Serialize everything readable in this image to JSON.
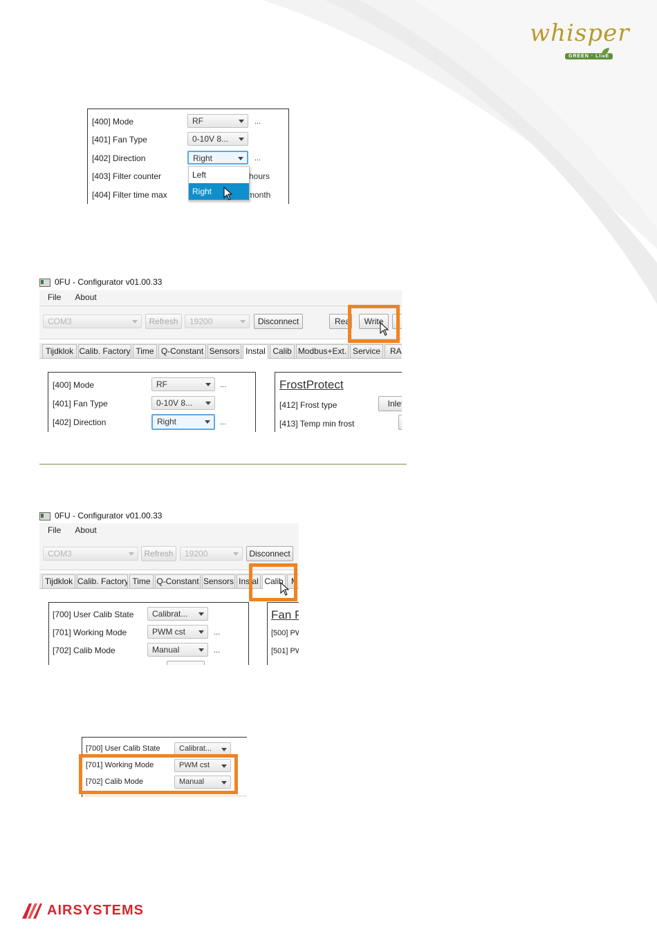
{
  "brand": {
    "whisper": "whisper",
    "whisper_sub": "GREEN · LINE",
    "footer": "AIRSYSTEMS",
    "accent_orange": "#f08321",
    "footer_red": "#d6262f",
    "gold": "#b89a2a"
  },
  "panel1": {
    "rows": [
      {
        "label": "[400] Mode",
        "value": "RF",
        "extra": "..."
      },
      {
        "label": "[401] Fan Type",
        "value": "0-10V 8...",
        "extra": ""
      },
      {
        "label": "[402] Direction",
        "value": "Right",
        "extra": "..."
      },
      {
        "label": "[403] Filter counter",
        "value": "",
        "extra": "hours"
      },
      {
        "label": "[404] Filter time max",
        "value": "",
        "extra": "month"
      }
    ],
    "dropdown": [
      "Left",
      "Right"
    ]
  },
  "window1": {
    "title": "0FU - Configurator v01.00.33",
    "menu": [
      "File",
      "About"
    ],
    "port": "COM3",
    "refresh": "Refresh",
    "baud": "19200",
    "disconnect": "Disconnect",
    "read": "Read",
    "write": "Write",
    "tabs": [
      "Tijdklok",
      "Calib. Factory",
      "Time",
      "Q-Constant",
      "Sensors",
      "Instal",
      "Calib",
      "Modbus+Ext.",
      "Service",
      "RAM"
    ],
    "rows": [
      {
        "label": "[400] Mode",
        "value": "RF",
        "extra": "..."
      },
      {
        "label": "[401] Fan Type",
        "value": "0-10V 8...",
        "extra": ""
      },
      {
        "label": "[402] Direction",
        "value": "Right",
        "extra": "..."
      }
    ],
    "frost": {
      "title": "FrostProtect",
      "rows": [
        {
          "label": "[412] Frost type",
          "value": "Inlet"
        },
        {
          "label": "[413] Temp min frost",
          "value": ""
        }
      ]
    }
  },
  "window2": {
    "title": "0FU - Configurator v01.00.33",
    "menu": [
      "File",
      "About"
    ],
    "port": "COM3",
    "refresh": "Refresh",
    "baud": "19200",
    "disconnect": "Disconnect",
    "tabs": [
      "Tijdklok",
      "Calib. Factory",
      "Time",
      "Q-Constant",
      "Sensors",
      "Instal",
      "Calib",
      "M"
    ],
    "rows": [
      {
        "label": "[700] User Calib State",
        "value": "Calibrat...",
        "extra": ""
      },
      {
        "label": "[701] Working Mode",
        "value": "PWM cst",
        "extra": "..."
      },
      {
        "label": "[702] Calib Mode",
        "value": "Manual",
        "extra": "..."
      }
    ],
    "fan": {
      "title": "Fan P",
      "rows": [
        "[500] PW",
        "[501] PW"
      ]
    }
  },
  "panel4": {
    "rows": [
      {
        "label": "[700] User Calib State",
        "value": "Calibrat..."
      },
      {
        "label": "[701] Working Mode",
        "value": "PWM cst"
      },
      {
        "label": "[702] Calib Mode",
        "value": "Manual"
      }
    ]
  }
}
